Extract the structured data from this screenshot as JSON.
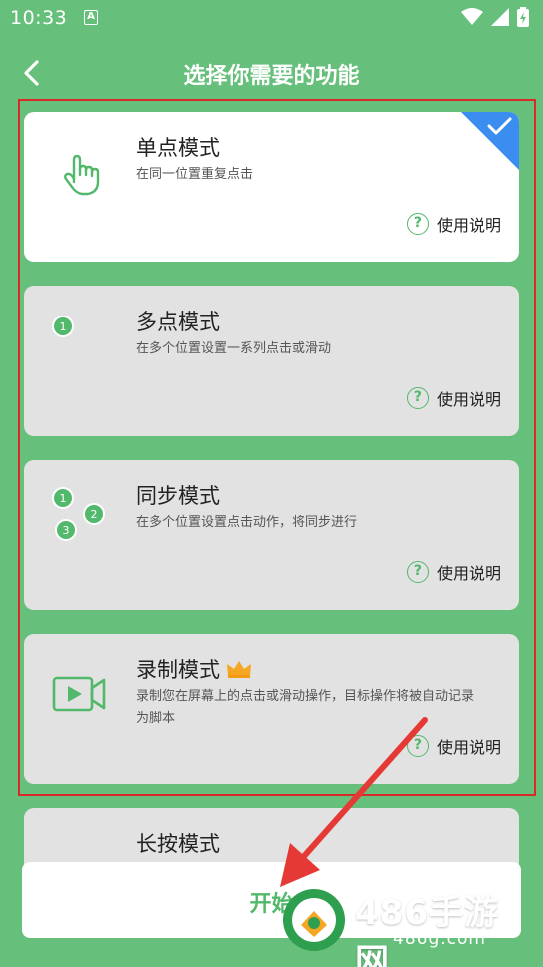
{
  "status": {
    "time": "10:33",
    "badge": "A"
  },
  "header": {
    "title": "选择你需要的功能"
  },
  "help_label": "使用说明",
  "modes": [
    {
      "title": "单点模式",
      "desc": "在同一位置重复点击",
      "selected": true
    },
    {
      "title": "多点模式",
      "desc": "在多个位置设置一系列点击或滑动",
      "badges": [
        "1"
      ]
    },
    {
      "title": "同步模式",
      "desc": "在多个位置设置点击动作，将同步进行",
      "badges": [
        "1",
        "2",
        "3"
      ]
    },
    {
      "title": "录制模式",
      "desc": "录制您在屏幕上的点击或滑动操作，目标操作将被自动记录为脚本",
      "premium": true
    },
    {
      "title": "长按模式"
    }
  ],
  "start_button": {
    "label": "开始"
  },
  "watermark": {
    "title": "486手游网",
    "sub": "486g.com"
  },
  "colors": {
    "background": "#66c07b",
    "accent": "#52b86b",
    "selection_corner": "#3b8ef0",
    "highlight_frame": "#d92a2a"
  }
}
